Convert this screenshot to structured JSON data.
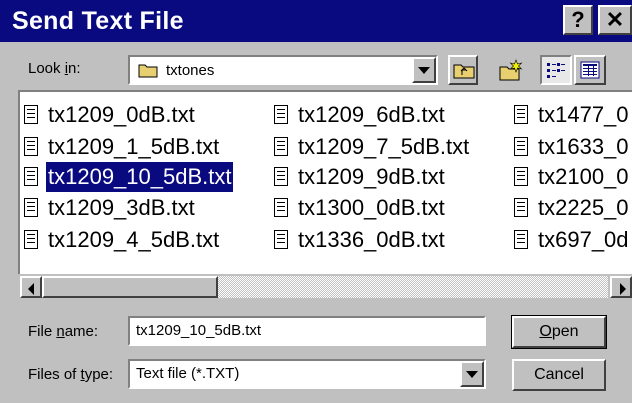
{
  "window": {
    "title": "Send Text File",
    "help_label": "?",
    "close_label": "✕"
  },
  "look_in": {
    "label_pre": "Look ",
    "label_u": "i",
    "label_post": "n:",
    "value": "txtones"
  },
  "files": {
    "col1": [
      "tx1209_0dB.txt",
      "tx1209_1_5dB.txt",
      "tx1209_10_5dB.txt",
      "tx1209_3dB.txt",
      "tx1209_4_5dB.txt"
    ],
    "col2": [
      "tx1209_6dB.txt",
      "tx1209_7_5dB.txt",
      "tx1209_9dB.txt",
      "tx1300_0dB.txt",
      "tx1336_0dB.txt"
    ],
    "col3": [
      "tx1477_0",
      "tx1633_0",
      "tx2100_0",
      "tx2225_0",
      "tx697_0d"
    ],
    "selected": "tx1209_10_5dB.txt"
  },
  "filename": {
    "label_pre": "File ",
    "label_u": "n",
    "label_post": "ame:",
    "value": "tx1209_10_5dB.txt"
  },
  "filetype": {
    "label_pre": "Files of ",
    "label_u": "t",
    "label_post": "ype:",
    "value": "Text file (*.TXT)"
  },
  "buttons": {
    "open_u": "O",
    "open_rest": "pen",
    "cancel": "Cancel"
  },
  "colors": {
    "titlebar": "#0a0a80",
    "face": "#c0c0c0",
    "selection": "#0a0a80"
  }
}
